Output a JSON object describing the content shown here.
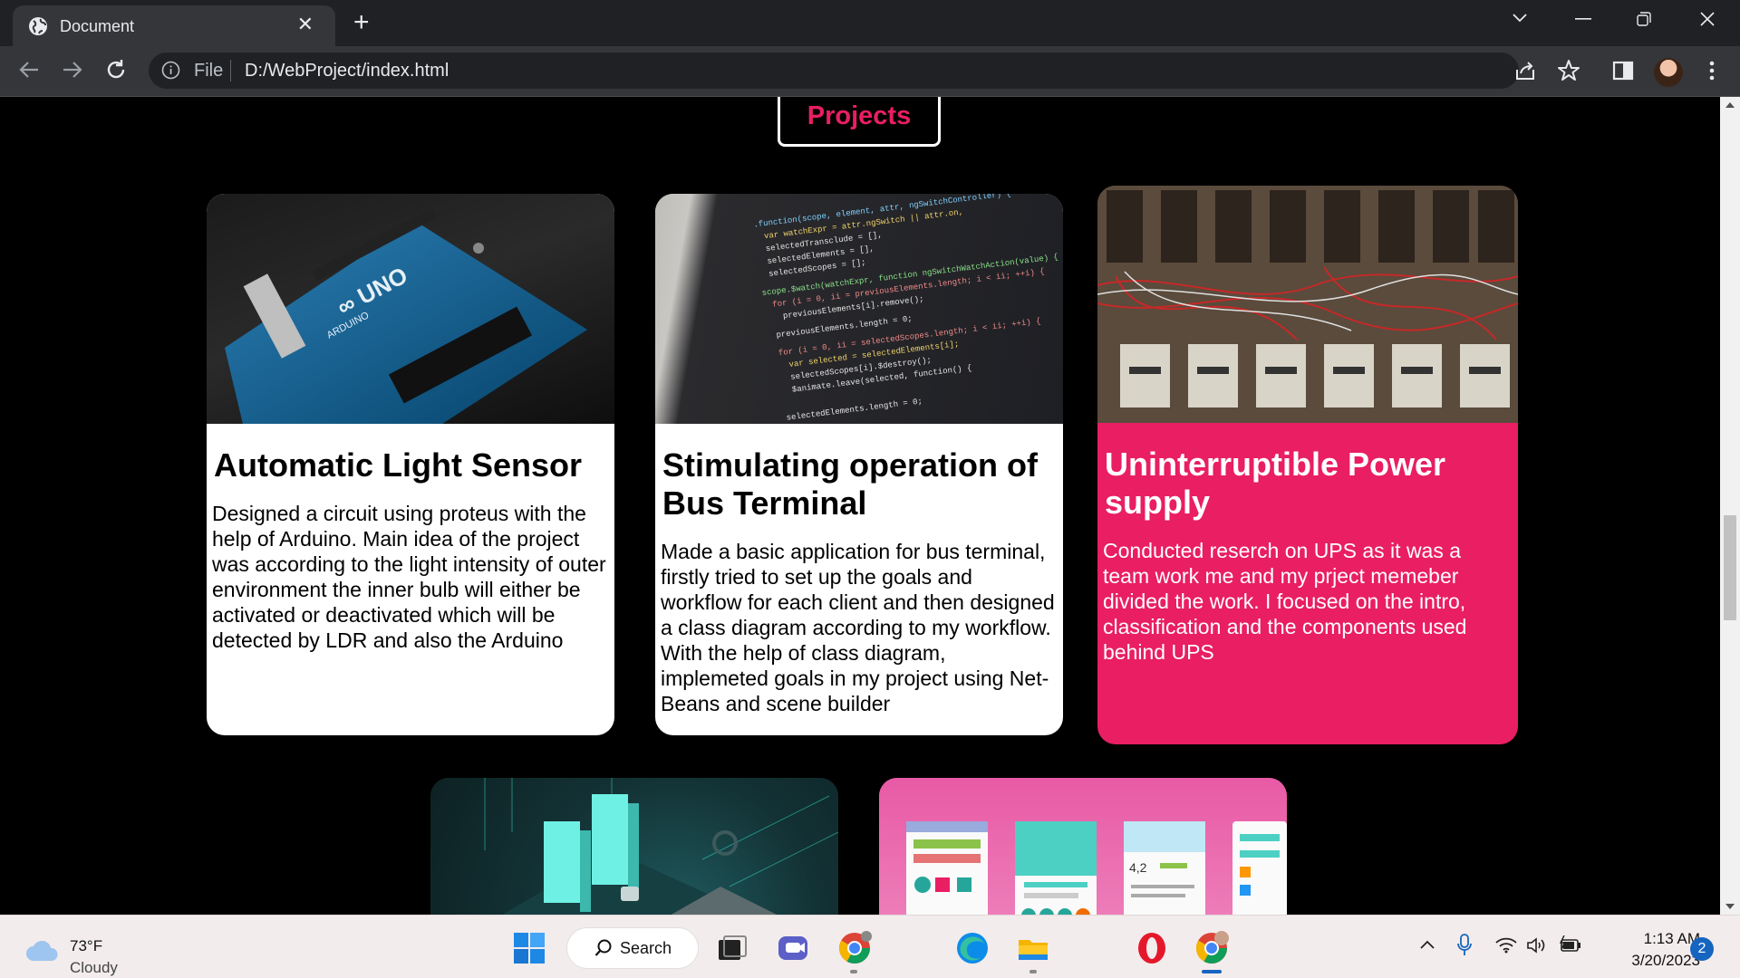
{
  "browser": {
    "tab_title": "Document",
    "new_tab_symbol": "+",
    "url_scheme": "File",
    "url": "D:/WebProject/index.html"
  },
  "page": {
    "section_heading": "Projects",
    "accent_color": "#e91e63",
    "cards": [
      {
        "title": "Automatic Light Sensor",
        "description": "Designed a circuit using proteus with the help of Arduino. Main idea of the project was according to the light intensity of outer environment the inner bulb will either be activated or deactivated which will be detected by LDR and also the Arduino",
        "image": "arduino-board-photo"
      },
      {
        "title": "Stimulating operation of Bus Terminal",
        "description": "Made a basic application for bus terminal, firstly tried to set up the goals and workflow for each client and then designed a class diagram according to my workflow. With the help of class diagram, implemeted goals in my project using Net-Beans and scene builder",
        "image": "code-on-screen-photo"
      },
      {
        "title": "Uninterruptible Power supply",
        "description": "Conducted reserch on UPS as it was a team work me and my prject memeber divided the work. I focused on the intro, classification and the components used behind UPS",
        "image": "electrical-panel-photo",
        "highlighted": true
      },
      {
        "image": "cloud-servers-illustration"
      },
      {
        "image": "mobile-apps-illustration"
      }
    ]
  },
  "taskbar": {
    "weather_temp": "73°F",
    "weather_condition": "Cloudy",
    "search_label": "Search",
    "time": "1:13 AM",
    "date": "3/20/2023",
    "notification_count": "2"
  }
}
